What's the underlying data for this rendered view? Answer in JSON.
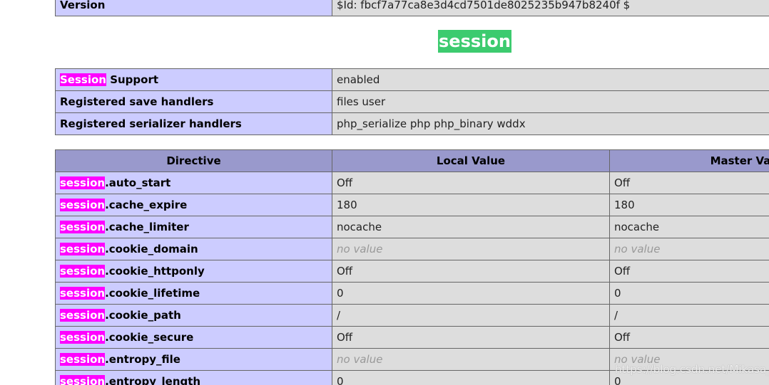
{
  "colors": {
    "label_cell": "#ccccff",
    "value_cell": "#dddddd",
    "header_cell": "#9999cc",
    "highlight": "#ff00ff",
    "section_heading": "#3ccb6f"
  },
  "version_row": {
    "label": "Version",
    "value": "$Id: fbcf7a77ca8e3d4cd7501de8025235b947b8240f $"
  },
  "section_heading": "session",
  "support": {
    "row1": {
      "label_highlight": "Session",
      "label_rest": " Support",
      "value": "enabled"
    },
    "row2": {
      "label": "Registered save handlers",
      "value": "files user"
    },
    "row3": {
      "label": "Registered serializer handlers",
      "value": "php_serialize php php_binary wddx"
    }
  },
  "directives": {
    "headers": {
      "directive": "Directive",
      "local": "Local Value",
      "master": "Master Value"
    },
    "prefix": "session",
    "rows": [
      {
        "suffix": ".auto_start",
        "local": "Off",
        "master": "Off"
      },
      {
        "suffix": ".cache_expire",
        "local": "180",
        "master": "180"
      },
      {
        "suffix": ".cache_limiter",
        "local": "nocache",
        "master": "nocache"
      },
      {
        "suffix": ".cookie_domain",
        "local": "no value",
        "master": "no value"
      },
      {
        "suffix": ".cookie_httponly",
        "local": "Off",
        "master": "Off"
      },
      {
        "suffix": ".cookie_lifetime",
        "local": "0",
        "master": "0"
      },
      {
        "suffix": ".cookie_path",
        "local": "/",
        "master": "/"
      },
      {
        "suffix": ".cookie_secure",
        "local": "Off",
        "master": "Off"
      },
      {
        "suffix": ".entropy_file",
        "local": "no value",
        "master": "no value"
      },
      {
        "suffix": ".entropy_length",
        "local": "0",
        "master": "0"
      }
    ]
  },
  "watermark": "https://blog.csdn.net/Mikasa_"
}
